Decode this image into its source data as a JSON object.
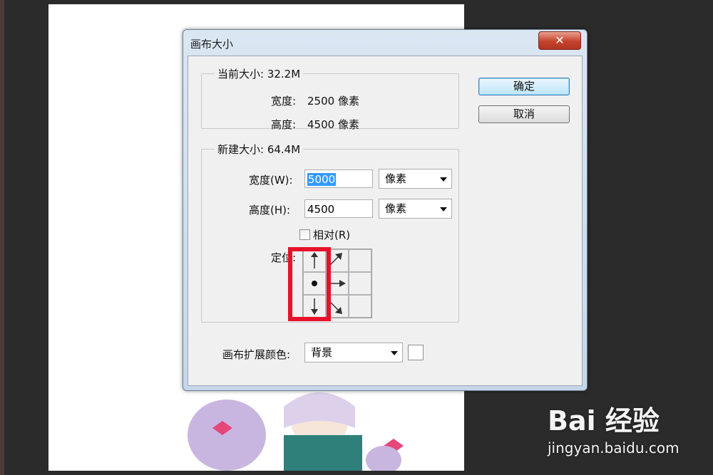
{
  "dialog": {
    "title": "画布大小",
    "close_symbol": "✕",
    "ok_label": "确定",
    "cancel_label": "取消"
  },
  "current_size": {
    "legend": "当前大小: 32.2M",
    "width_label": "宽度:",
    "width_value": "2500 像素",
    "height_label": "高度:",
    "height_value": "4500 像素"
  },
  "new_size": {
    "legend": "新建大小: 64.4M",
    "width_label": "宽度(W):",
    "width_value": "5000",
    "width_unit": "像素",
    "height_label": "高度(H):",
    "height_value": "4500",
    "height_unit": "像素",
    "relative_label": "相对(R)",
    "relative_checked": false,
    "anchor_label": "定位:"
  },
  "extension_color": {
    "label": "画布扩展颜色:",
    "value": "背景",
    "swatch_color": "#ffffff"
  },
  "watermark": {
    "brand": "Bai 经验",
    "url": "jingyan.baidu.com"
  },
  "colors": {
    "highlight": "#e8102a",
    "selection": "#3399ff"
  }
}
